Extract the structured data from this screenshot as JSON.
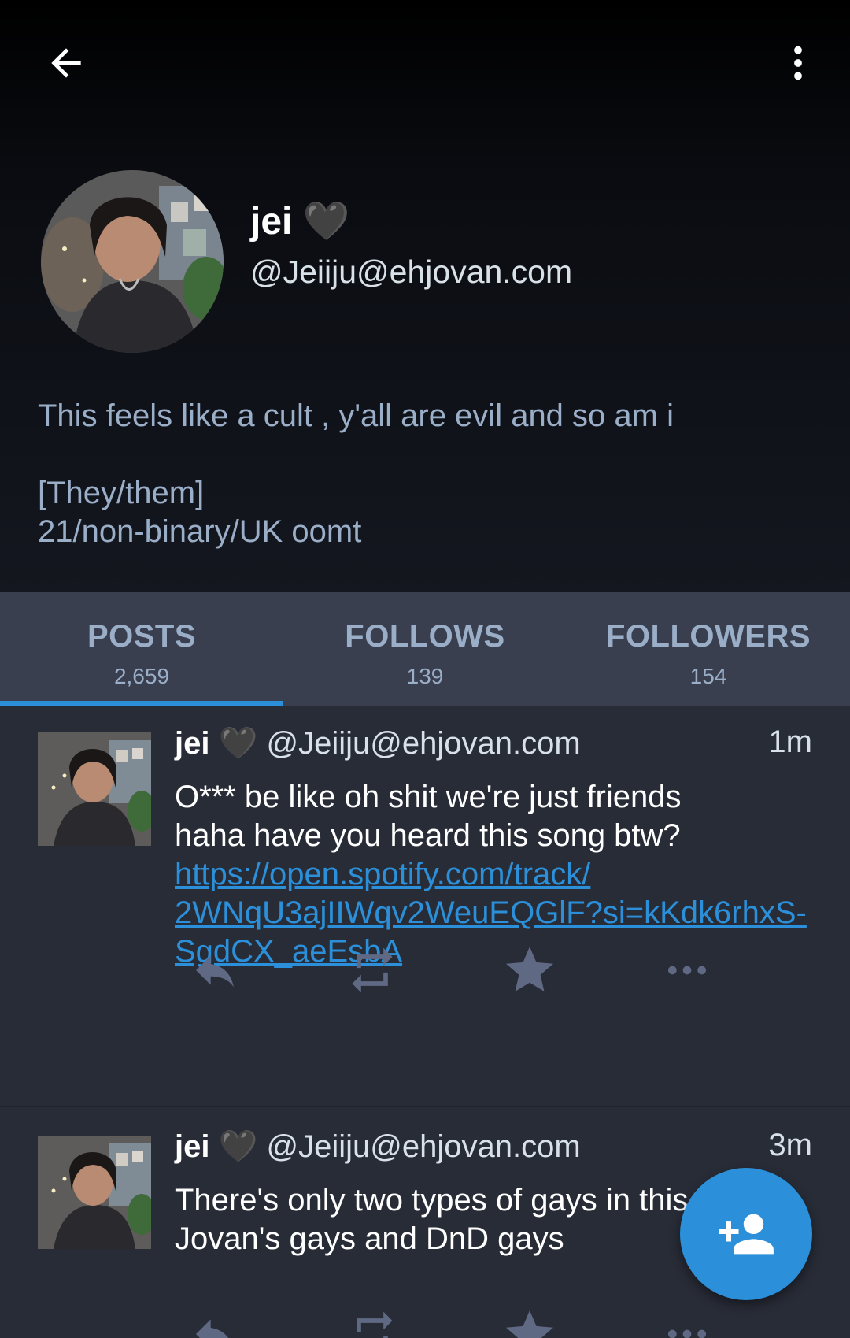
{
  "profile": {
    "display_name": "jei 🖤",
    "handle": "@Jeiiju@ehjovan.com",
    "bio_lines": [
      "This feels like a cult , y'all are evil and so am i",
      "[They/them]",
      "21/non-binary/UK oomt"
    ]
  },
  "tabs": [
    {
      "label": "POSTS",
      "count": "2,659",
      "active": true
    },
    {
      "label": "FOLLOWS",
      "count": "139",
      "active": false
    },
    {
      "label": "FOLLOWERS",
      "count": "154",
      "active": false
    }
  ],
  "posts": [
    {
      "author": "jei 🖤",
      "handle": "@Jeiiju@ehjovan.com",
      "time": "1m",
      "text_lines": [
        "O*** be like oh shit we're just friends",
        "haha have you heard this song btw?"
      ],
      "link_lines": [
        "https://open.spotify.com/track/",
        "2WNqU3ajIIWqv2WeuEQGlF?si=kKdk6rhxS-",
        "SgdCX_aeEsbA"
      ]
    },
    {
      "author": "jei 🖤",
      "handle": "@Jeiiju@ehjovan.com",
      "time": "3m",
      "text_lines": [
        "There's only two types of gays in this site",
        "Jovan's gays and DnD gays"
      ]
    }
  ],
  "icons": {
    "back": "arrow-left-icon",
    "menu": "more-vertical-icon",
    "reply": "reply-icon",
    "boost": "boost-icon",
    "favourite": "star-icon",
    "more": "more-horizontal-icon",
    "fab": "follow-person-add-icon"
  },
  "colors": {
    "accent": "#2b90d9",
    "background": "#282c37",
    "tab_bar": "#393f4f",
    "muted_text": "#9baec8",
    "icon": "#606984"
  }
}
